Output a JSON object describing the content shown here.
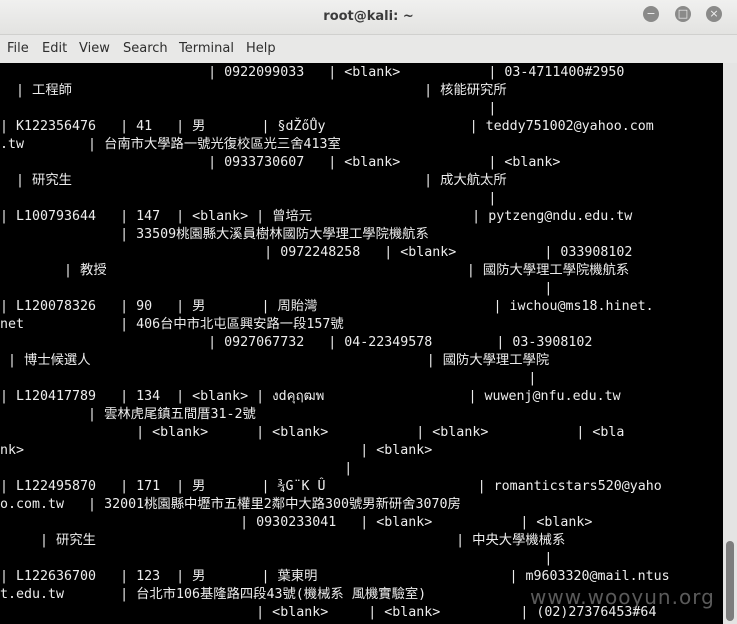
{
  "window": {
    "title": "root@kali: ~"
  },
  "menu": [
    "File",
    "Edit",
    "View",
    "Search",
    "Terminal",
    "Help"
  ],
  "terminal": {
    "lines": [
      "                          | 0922099033   | <blank>           | 03-4711400#2950",
      "  | 工程師                                            | 核能研究所",
      "                                                             |",
      "| K122356476   | 41   | 男       | §dŽőŮy                  | teddy751002@yahoo.com",
      ".tw        | 台南市大學路一號光復校區光三舍413室",
      "                          | 0933730607   | <blank>           | <blank>",
      "  | 研究生                                            | 成大航太所",
      "                                                             |",
      "| L100793644   | 147  | <blank> | 曾培元                    | pytzeng@ndu.edu.tw",
      "               | 33509桃園縣大溪員樹林國防大學理工學院機航系",
      "                                 | 0972248258   | <blank>           | 033908102",
      "        | 教授                                             | 國防大學理工學院機航系",
      "                                                                    |",
      "| L120078326   | 90   | 男       | 周貽灣                      | iwchou@ms18.hinet.",
      "net            | 406台中市北屯區興安路一段157號",
      "                          | 0927067732   | 04-22349578        | 03-3908102",
      " | 博士候選人                                          | 國防大學理工學院",
      "                                                                  |",
      "| L120417789   | 134  | <blank> | งdคุฤฒพ                  | wuwenj@nfu.edu.tw",
      "           | 雲林虎尾鎮五間厝31-2號",
      "                 | <blank>      | <blank>           | <blank>           | <bla",
      "nk>                                          | <blank>",
      "                                           |",
      "| L122495870   | 171  | 男       | ¾G¨K Û                   | romanticstars520@yaho",
      "o.com.tw   | 32001桃園縣中壢市五權里2鄰中大路300號男新研舍3070房",
      "                              | 0930233041   | <blank>           | <blank>",
      "     | 研究生                                             | 中央大學機械系",
      "                                                                    |",
      "| L122636700   | 123  | 男       | 葉東明                        | m9603320@mail.ntus",
      "t.edu.tw       | 台北市106基隆路四段43號(機械系 風機實驗室)",
      "                                | <blank>     | <blank>          | (02)27376453#64"
    ]
  },
  "watermark": "www.wooyun.org"
}
